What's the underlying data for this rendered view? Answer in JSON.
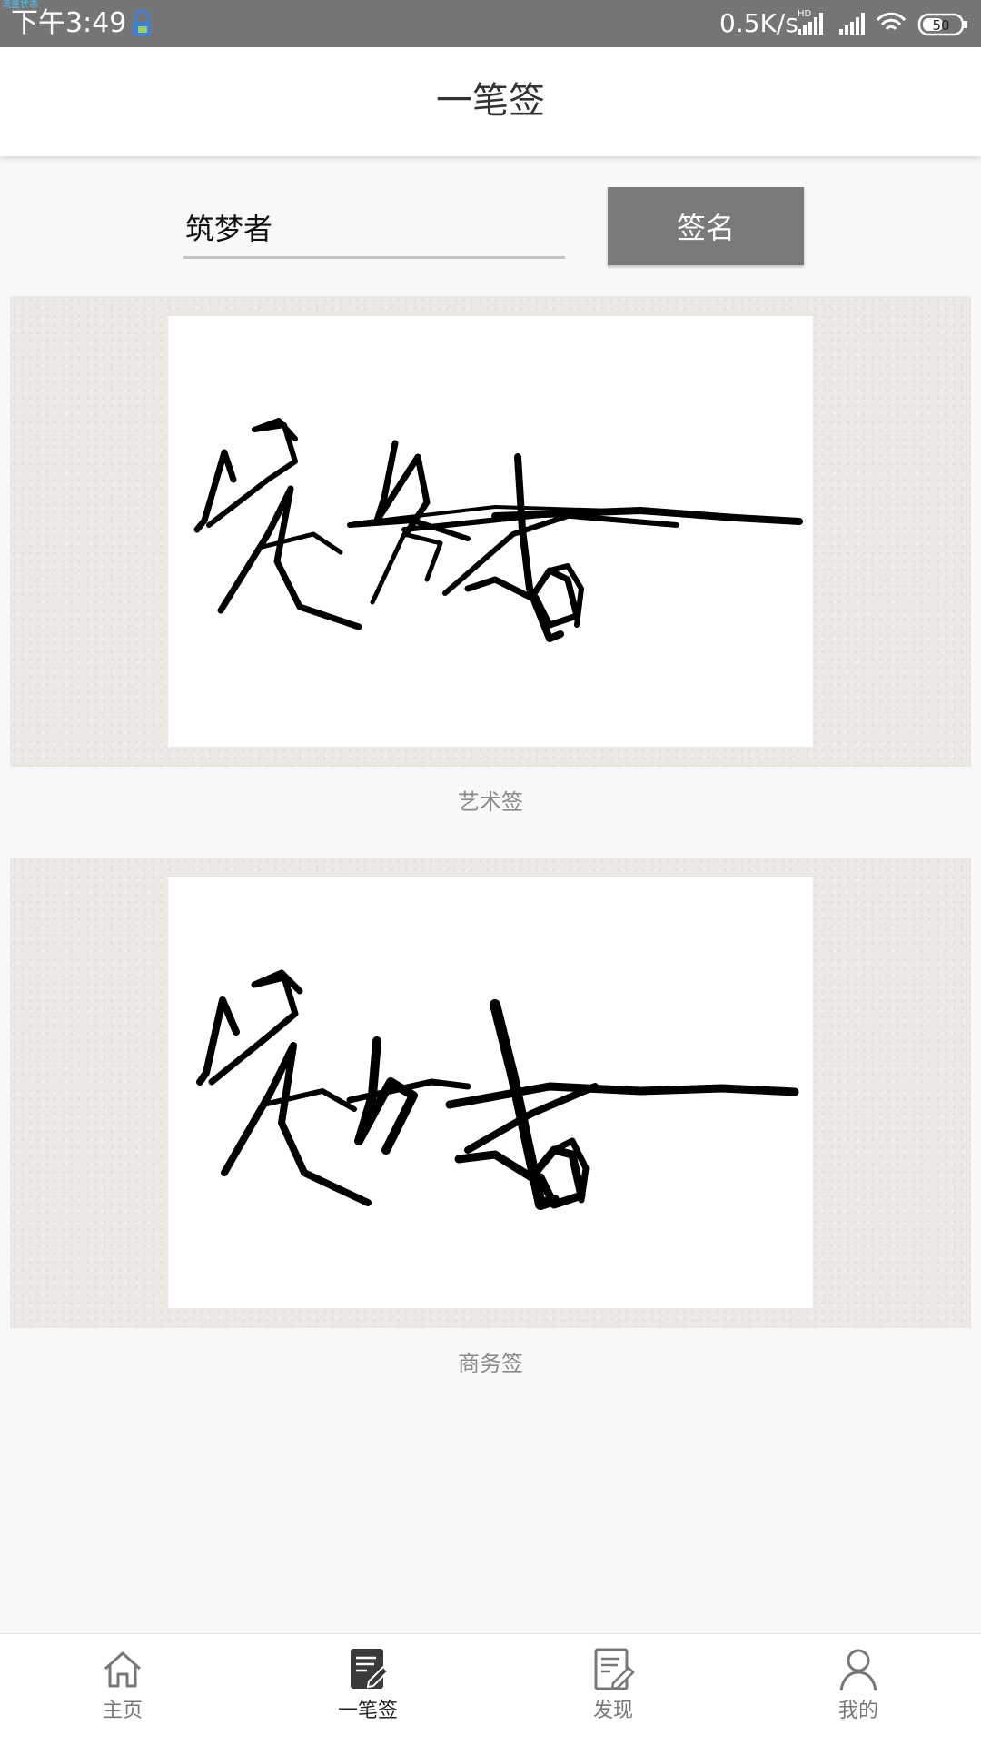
{
  "status_bar": {
    "overlay_text": "流量状态",
    "time": "下午3:49",
    "net_speed": "0.5K/s",
    "hd_label": "HD",
    "battery": "50"
  },
  "app_bar": {
    "title": "一笔签"
  },
  "form": {
    "name_value": "筑梦者",
    "sign_button_label": "签名"
  },
  "signatures": [
    {
      "caption": "艺术签"
    },
    {
      "caption": "商务签"
    }
  ],
  "bottom_nav": {
    "items": [
      {
        "label": "主页",
        "icon": "home-icon"
      },
      {
        "label": "一笔签",
        "icon": "edit-note-icon",
        "active": true
      },
      {
        "label": "发现",
        "icon": "write-icon"
      },
      {
        "label": "我的",
        "icon": "person-icon"
      }
    ]
  },
  "colors": {
    "status_bar": "#757575",
    "button": "#7a7a7a",
    "panel_bg": "#ece8e3"
  }
}
